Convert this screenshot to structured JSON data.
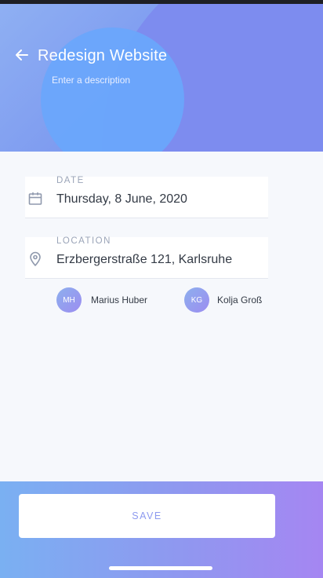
{
  "header": {
    "back_icon": "arrow-left-icon",
    "title": "Redesign Website",
    "subtitle": "Enter a description",
    "colors": {
      "gradient_start": "#8fb0f3",
      "gradient_end": "#7b8cf1",
      "circle": "#6aa6fb"
    }
  },
  "form": {
    "date": {
      "label": "DATE",
      "value": "Thursday, 8 June, 2020",
      "icon": "calendar-icon"
    },
    "location": {
      "label": "LOCATION",
      "value": "Erzbergerstraße 121, Karlsruhe",
      "icon": "location-pin-icon"
    }
  },
  "attendees": [
    {
      "initials": "MH",
      "name": "Marius Huber"
    },
    {
      "initials": "KG",
      "name": "Kolja Groß"
    }
  ],
  "footer": {
    "save_label": "SAVE",
    "colors": {
      "gradient_start": "#7ab0f2",
      "gradient_end": "#a586f2",
      "button_text": "#8d9aef"
    }
  }
}
